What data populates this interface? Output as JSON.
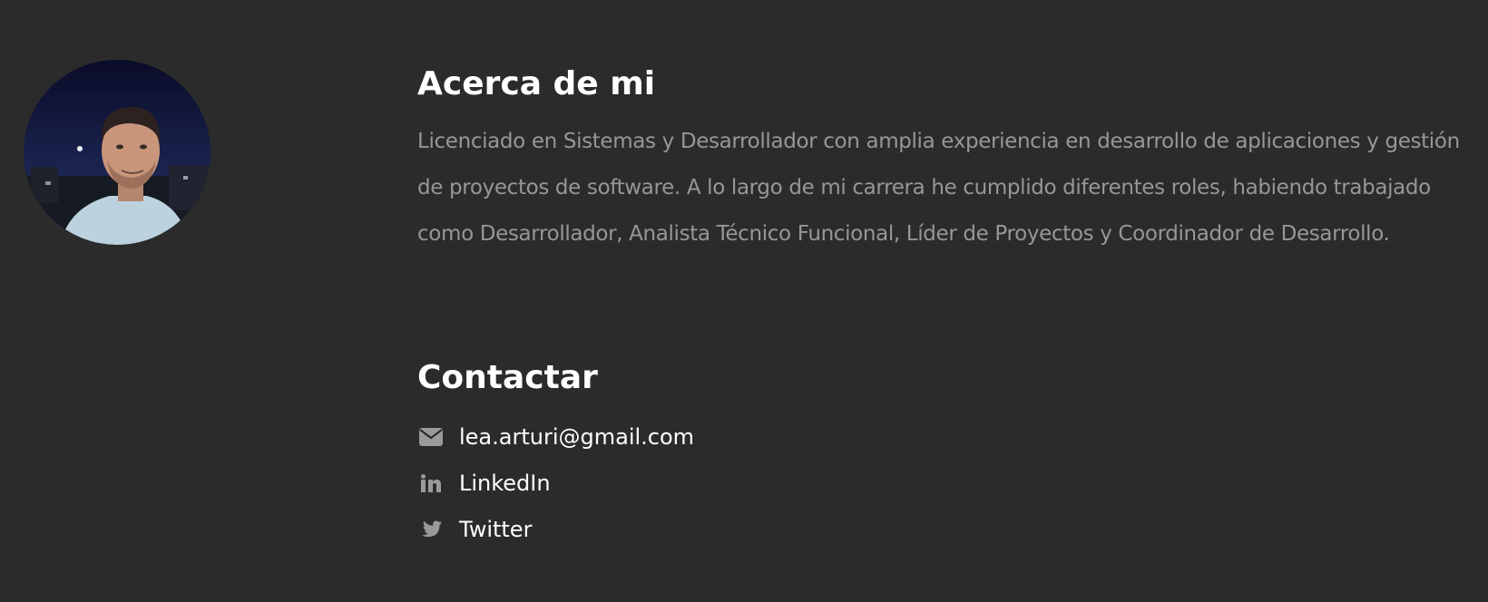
{
  "about": {
    "heading": "Acerca de mi",
    "text": "Licenciado en Sistemas y Desarrollador con amplia experiencia en desarrollo de aplicaciones y gestión de proyectos de software. A lo largo de mi carrera he cumplido diferentes roles, habiendo trabajado como Desarrollador, Analista Técnico Funcional, Líder de Proyectos y Coordinador de Desarrollo."
  },
  "contact": {
    "heading": "Contactar",
    "items": [
      {
        "icon": "envelope-icon",
        "label": "lea.arturi@gmail.com"
      },
      {
        "icon": "linkedin-icon",
        "label": "LinkedIn"
      },
      {
        "icon": "twitter-icon",
        "label": "Twitter"
      }
    ]
  },
  "colors": {
    "background": "#2b2b2b",
    "heading": "#ffffff",
    "body_text": "#979797",
    "icon": "#9a9a9a",
    "link": "#ffffff"
  }
}
